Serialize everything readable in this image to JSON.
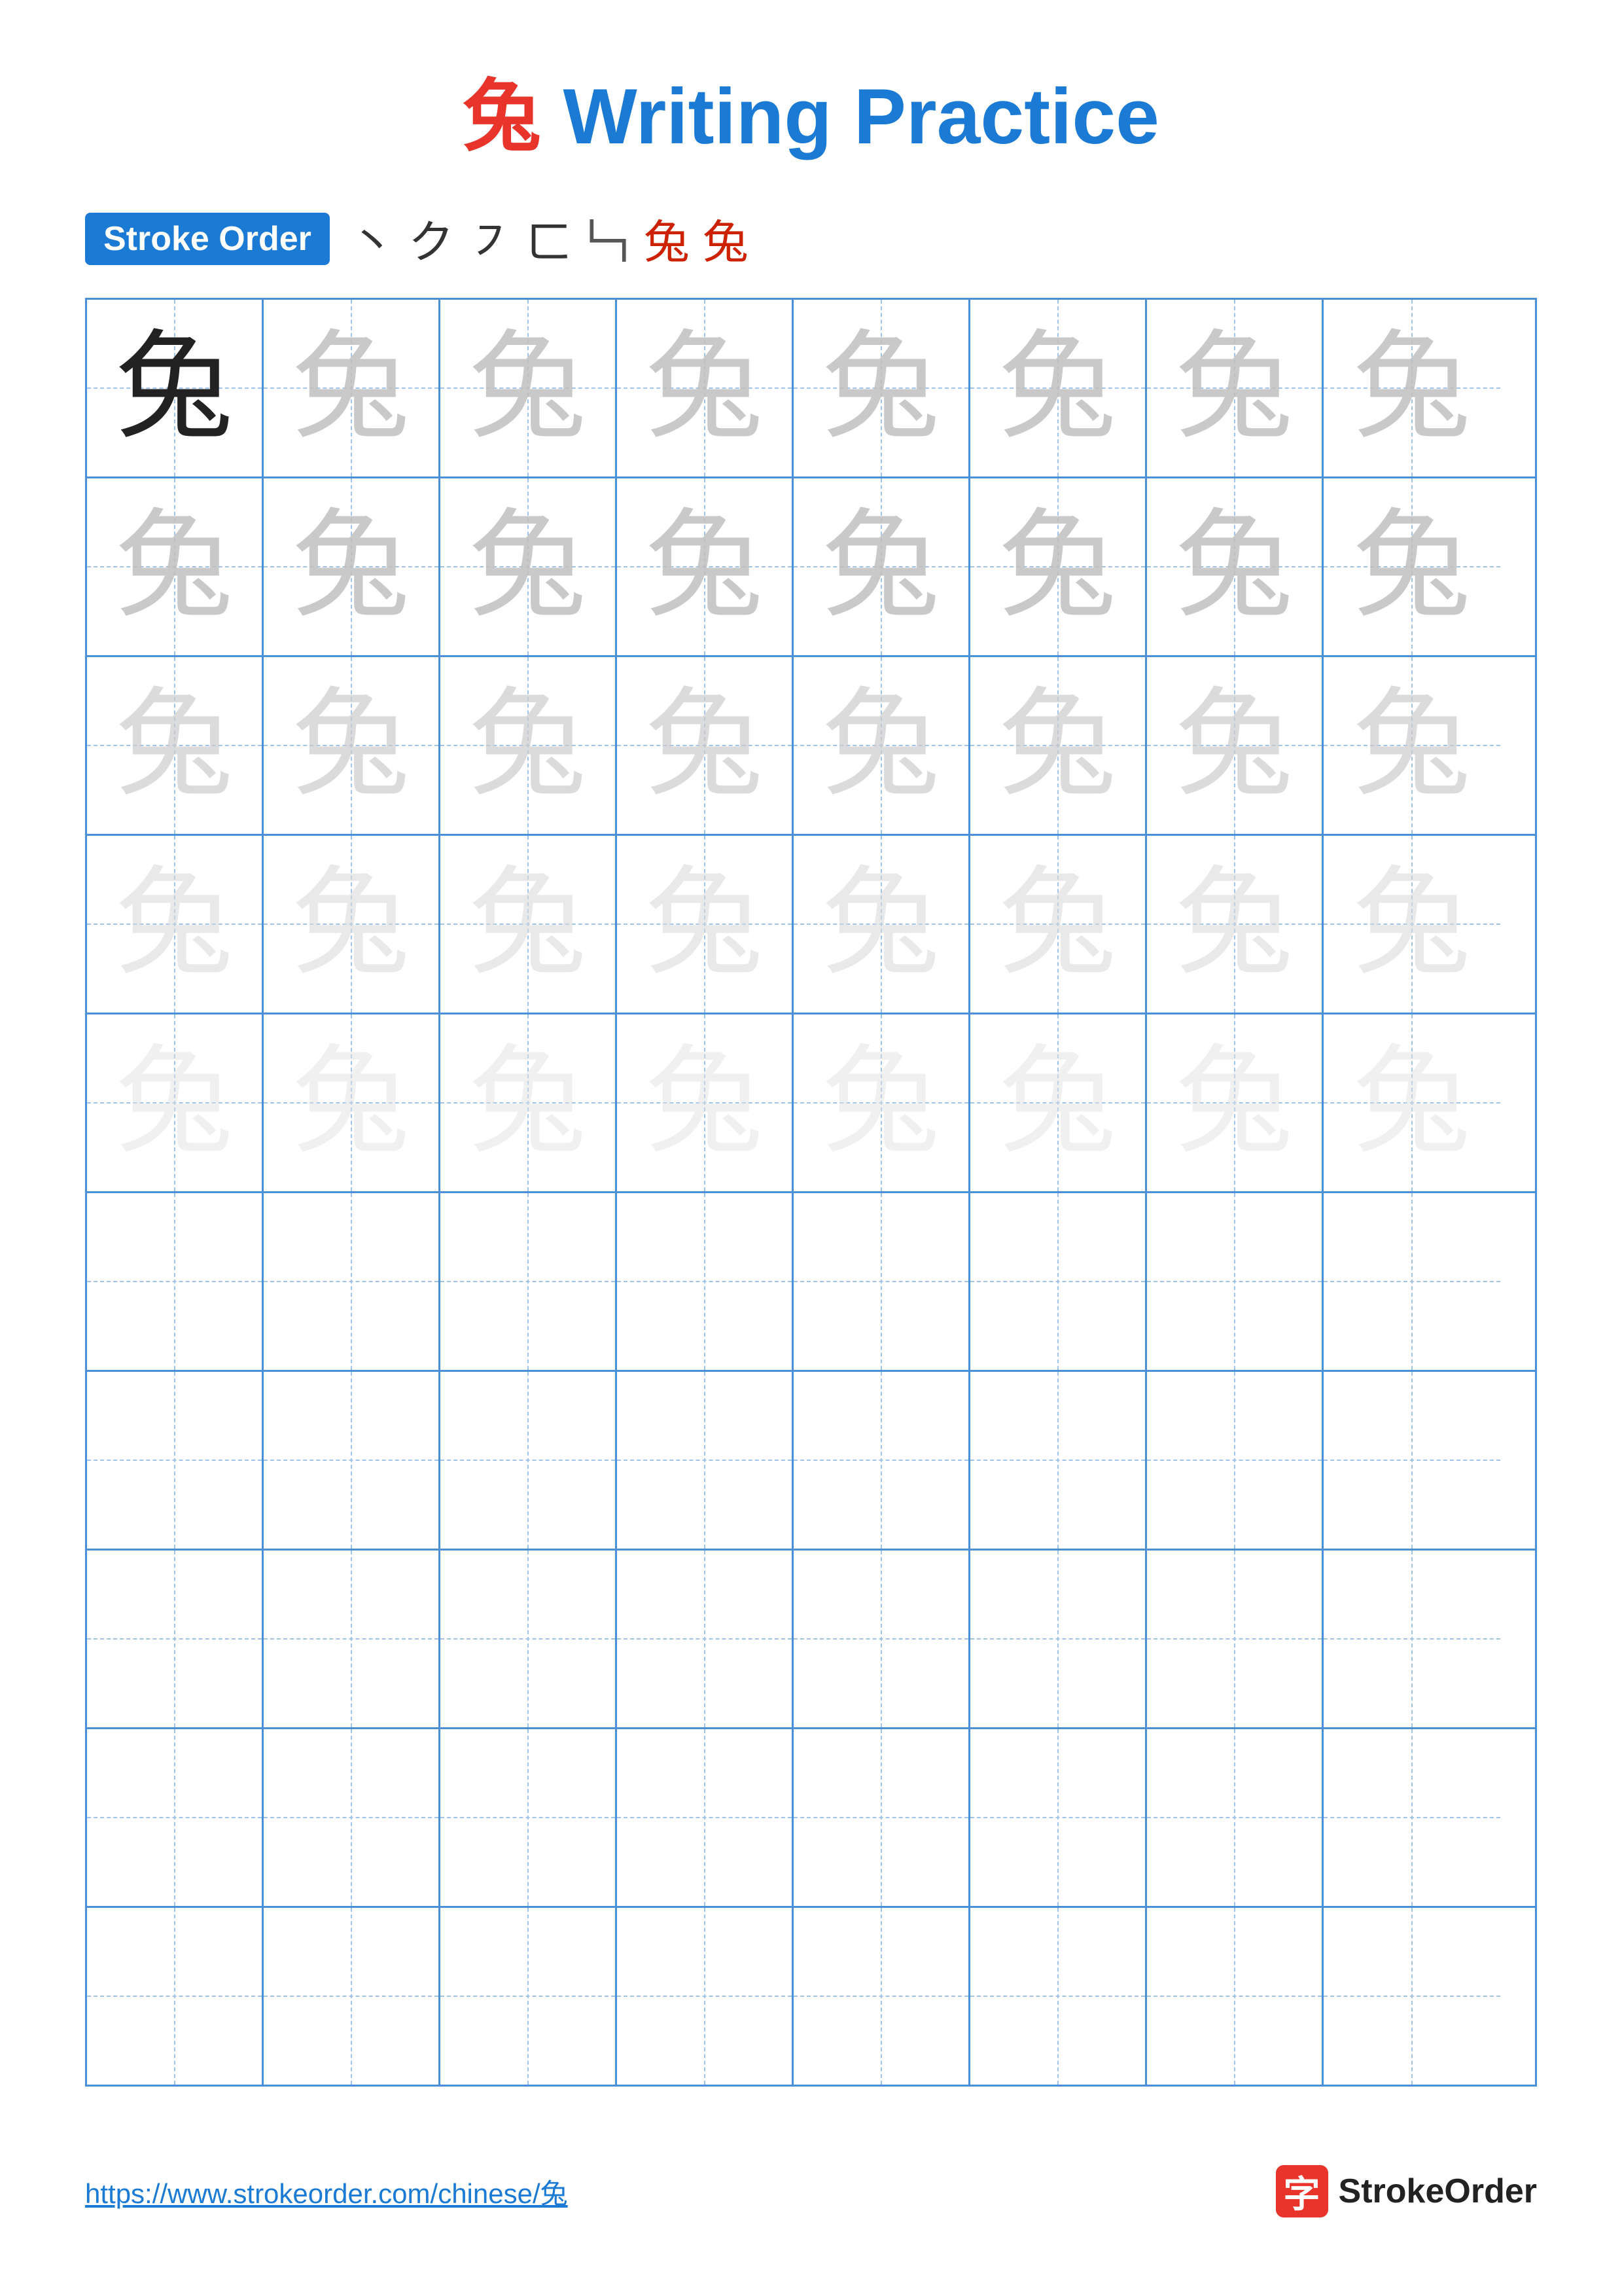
{
  "title": {
    "char": "兔",
    "text": " Writing Practice"
  },
  "stroke_order": {
    "badge_label": "Stroke Order",
    "strokes": [
      "丶",
      "ク",
      "㇇",
      "ㄈ",
      "𠃑",
      "兔",
      "兔"
    ]
  },
  "grid": {
    "rows": 10,
    "cols": 8,
    "char": "兔"
  },
  "footer": {
    "url": "https://www.strokeorder.com/chinese/兔",
    "logo_char": "字",
    "logo_text": "StrokeOrder"
  }
}
